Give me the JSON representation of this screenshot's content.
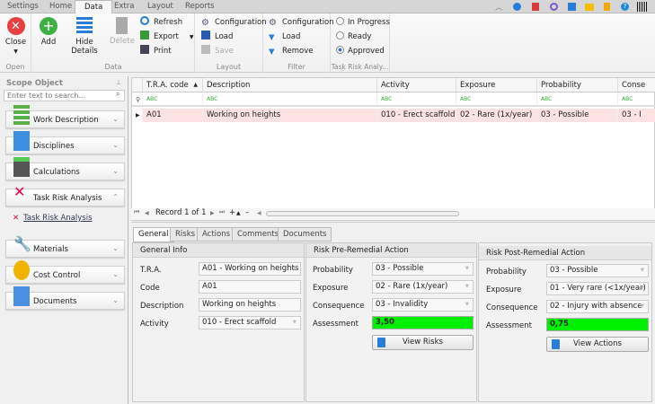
{
  "ribbon_tabs": [
    "Settings",
    "Home",
    "Data",
    "Extra",
    "Layout",
    "Reports"
  ],
  "active_tab": "Data",
  "ribbon": {
    "open": {
      "label": "Open",
      "close": "Close"
    },
    "data": {
      "label": "Data",
      "add": "Add",
      "hide_details": "Hide Details",
      "delete": "Delete",
      "refresh": "Refresh",
      "export": "Export",
      "print": "Print"
    },
    "layout": {
      "label": "Layout",
      "configuration": "Configuration",
      "load": "Load",
      "save": "Save"
    },
    "filter": {
      "label": "Filter",
      "configuration": "Configuration",
      "load": "Load",
      "remove": "Remove"
    },
    "tra": {
      "label": "Task Risk Analy...",
      "in_progress": "In Progress",
      "ready": "Ready",
      "approved": "Approved",
      "selected": "Approved"
    }
  },
  "sidebar": {
    "title": "Scope Object",
    "search_placeholder": "Enter text to search...",
    "groups": [
      {
        "label": "Work Description",
        "icon": "bars-icon"
      },
      {
        "label": "Disciplines",
        "icon": "grid-icon"
      },
      {
        "label": "Calculations",
        "icon": "calculator-icon"
      },
      {
        "label": "Task Risk Analysis",
        "icon": "tra-icon",
        "expanded": true
      },
      {
        "label": "Materials",
        "icon": "wrench-icon"
      },
      {
        "label": "Cost Control",
        "icon": "coins-icon"
      },
      {
        "label": "Documents",
        "icon": "document-icon"
      }
    ],
    "sub_item": "Task Risk Analysis"
  },
  "grid": {
    "columns": [
      "T.R.A. code",
      "Description",
      "Activity",
      "Exposure",
      "Probability",
      "Conse"
    ],
    "filter_text": "ABC",
    "rows": [
      [
        "A01",
        "Working on heights",
        "010 - Erect scaffold",
        "02 - Rare (1x/year)",
        "03 - Possible",
        "03 - I"
      ]
    ],
    "record": "Record 1 of 1"
  },
  "detail_tabs": [
    "General",
    "Risks",
    "Actions",
    "Comments",
    "Documents"
  ],
  "general": {
    "title": "General Info",
    "tra_label": "T.R.A.",
    "tra": "A01 - Working on heights",
    "code_label": "Code",
    "code": "A01",
    "desc_label": "Description",
    "desc": "Working on heights",
    "activity_label": "Activity",
    "activity": "010 - Erect scaffold"
  },
  "pre": {
    "title": "Risk Pre-Remedial Action",
    "prob_label": "Probability",
    "prob": "03 - Possible",
    "exp_label": "Exposure",
    "exp": "02 - Rare (1x/year)",
    "cons_label": "Consequence",
    "cons": "03 - Invalidity",
    "assess_label": "Assessment",
    "assess": "3,50",
    "button": "View Risks"
  },
  "post": {
    "title": "Risk Post-Remedial Action",
    "prob_label": "Probability",
    "prob": "03 - Possible",
    "exp_label": "Exposure",
    "exp": "01 - Very rare (<1x/year)",
    "cons_label": "Consequence",
    "cons": "02 - Injury with absence",
    "assess_label": "Assessment",
    "assess": "0,75",
    "button": "View Actions"
  },
  "colors": {
    "highlight_row": "#fde2e2",
    "assessment": "#00f000",
    "accent": "#2a7dd6"
  }
}
